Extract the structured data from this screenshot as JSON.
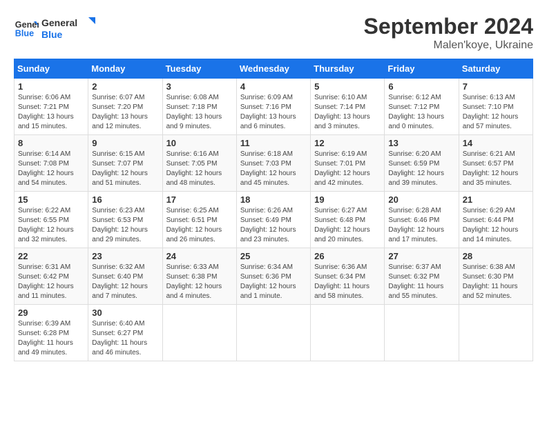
{
  "header": {
    "logo_line1": "General",
    "logo_line2": "Blue",
    "month": "September 2024",
    "location": "Malen'koye, Ukraine"
  },
  "weekdays": [
    "Sunday",
    "Monday",
    "Tuesday",
    "Wednesday",
    "Thursday",
    "Friday",
    "Saturday"
  ],
  "weeks": [
    [
      {
        "day": "1",
        "sunrise": "6:06 AM",
        "sunset": "7:21 PM",
        "daylight": "13 hours and 15 minutes."
      },
      {
        "day": "2",
        "sunrise": "6:07 AM",
        "sunset": "7:20 PM",
        "daylight": "13 hours and 12 minutes."
      },
      {
        "day": "3",
        "sunrise": "6:08 AM",
        "sunset": "7:18 PM",
        "daylight": "13 hours and 9 minutes."
      },
      {
        "day": "4",
        "sunrise": "6:09 AM",
        "sunset": "7:16 PM",
        "daylight": "13 hours and 6 minutes."
      },
      {
        "day": "5",
        "sunrise": "6:10 AM",
        "sunset": "7:14 PM",
        "daylight": "13 hours and 3 minutes."
      },
      {
        "day": "6",
        "sunrise": "6:12 AM",
        "sunset": "7:12 PM",
        "daylight": "13 hours and 0 minutes."
      },
      {
        "day": "7",
        "sunrise": "6:13 AM",
        "sunset": "7:10 PM",
        "daylight": "12 hours and 57 minutes."
      }
    ],
    [
      {
        "day": "8",
        "sunrise": "6:14 AM",
        "sunset": "7:08 PM",
        "daylight": "12 hours and 54 minutes."
      },
      {
        "day": "9",
        "sunrise": "6:15 AM",
        "sunset": "7:07 PM",
        "daylight": "12 hours and 51 minutes."
      },
      {
        "day": "10",
        "sunrise": "6:16 AM",
        "sunset": "7:05 PM",
        "daylight": "12 hours and 48 minutes."
      },
      {
        "day": "11",
        "sunrise": "6:18 AM",
        "sunset": "7:03 PM",
        "daylight": "12 hours and 45 minutes."
      },
      {
        "day": "12",
        "sunrise": "6:19 AM",
        "sunset": "7:01 PM",
        "daylight": "12 hours and 42 minutes."
      },
      {
        "day": "13",
        "sunrise": "6:20 AM",
        "sunset": "6:59 PM",
        "daylight": "12 hours and 39 minutes."
      },
      {
        "day": "14",
        "sunrise": "6:21 AM",
        "sunset": "6:57 PM",
        "daylight": "12 hours and 35 minutes."
      }
    ],
    [
      {
        "day": "15",
        "sunrise": "6:22 AM",
        "sunset": "6:55 PM",
        "daylight": "12 hours and 32 minutes."
      },
      {
        "day": "16",
        "sunrise": "6:23 AM",
        "sunset": "6:53 PM",
        "daylight": "12 hours and 29 minutes."
      },
      {
        "day": "17",
        "sunrise": "6:25 AM",
        "sunset": "6:51 PM",
        "daylight": "12 hours and 26 minutes."
      },
      {
        "day": "18",
        "sunrise": "6:26 AM",
        "sunset": "6:49 PM",
        "daylight": "12 hours and 23 minutes."
      },
      {
        "day": "19",
        "sunrise": "6:27 AM",
        "sunset": "6:48 PM",
        "daylight": "12 hours and 20 minutes."
      },
      {
        "day": "20",
        "sunrise": "6:28 AM",
        "sunset": "6:46 PM",
        "daylight": "12 hours and 17 minutes."
      },
      {
        "day": "21",
        "sunrise": "6:29 AM",
        "sunset": "6:44 PM",
        "daylight": "12 hours and 14 minutes."
      }
    ],
    [
      {
        "day": "22",
        "sunrise": "6:31 AM",
        "sunset": "6:42 PM",
        "daylight": "12 hours and 11 minutes."
      },
      {
        "day": "23",
        "sunrise": "6:32 AM",
        "sunset": "6:40 PM",
        "daylight": "12 hours and 7 minutes."
      },
      {
        "day": "24",
        "sunrise": "6:33 AM",
        "sunset": "6:38 PM",
        "daylight": "12 hours and 4 minutes."
      },
      {
        "day": "25",
        "sunrise": "6:34 AM",
        "sunset": "6:36 PM",
        "daylight": "12 hours and 1 minute."
      },
      {
        "day": "26",
        "sunrise": "6:36 AM",
        "sunset": "6:34 PM",
        "daylight": "11 hours and 58 minutes."
      },
      {
        "day": "27",
        "sunrise": "6:37 AM",
        "sunset": "6:32 PM",
        "daylight": "11 hours and 55 minutes."
      },
      {
        "day": "28",
        "sunrise": "6:38 AM",
        "sunset": "6:30 PM",
        "daylight": "11 hours and 52 minutes."
      }
    ],
    [
      {
        "day": "29",
        "sunrise": "6:39 AM",
        "sunset": "6:28 PM",
        "daylight": "11 hours and 49 minutes."
      },
      {
        "day": "30",
        "sunrise": "6:40 AM",
        "sunset": "6:27 PM",
        "daylight": "11 hours and 46 minutes."
      },
      null,
      null,
      null,
      null,
      null
    ]
  ]
}
